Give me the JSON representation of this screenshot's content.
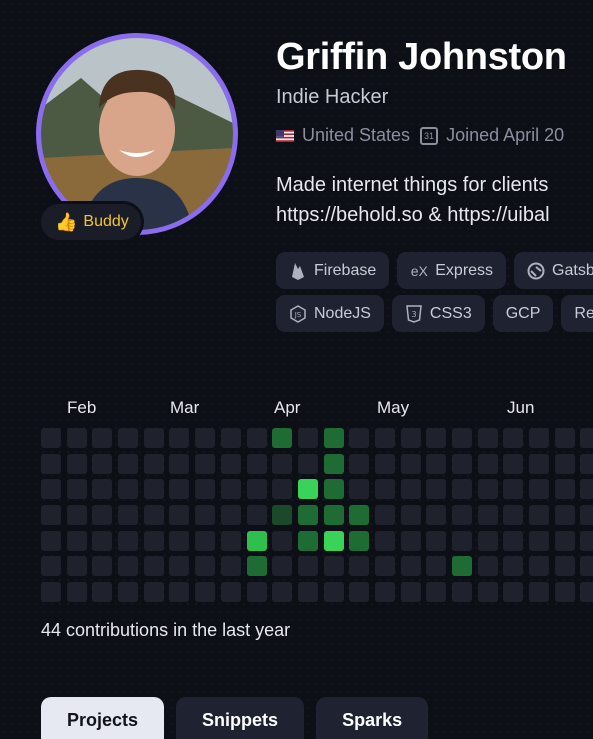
{
  "profile": {
    "name": "Griffin Johnston",
    "role": "Indie Hacker",
    "badge_label": "Buddy",
    "badge_icon": "thumbs-up-icon",
    "location": "United States",
    "joined": "Joined April 20",
    "bio_line1": "Made internet things for clients",
    "bio_line2": "https://behold.so & https://uibal"
  },
  "tags": {
    "row1": [
      {
        "label": "Firebase",
        "icon": "firebase-icon"
      },
      {
        "label": "Express",
        "icon": "express-icon"
      },
      {
        "label": "Gatsb",
        "icon": "gatsby-icon"
      }
    ],
    "row2": [
      {
        "label": "NodeJS",
        "icon": "nodejs-icon"
      },
      {
        "label": "CSS3",
        "icon": "css3-icon"
      },
      {
        "label": "GCP",
        "icon": ""
      },
      {
        "label": "Rea",
        "icon": ""
      }
    ]
  },
  "heatmap": {
    "months": [
      "Feb",
      "Mar",
      "Apr",
      "May",
      "Jun"
    ],
    "contributions_text": "44 contributions in the last year",
    "colors": {
      "empty": "#1f222c",
      "l1": "#1a4a2a",
      "l2": "#1e6b33",
      "l3": "#2fbf4f",
      "l4": "#39d35a"
    }
  },
  "tabs": [
    {
      "label": "Projects",
      "active": true
    },
    {
      "label": "Snippets",
      "active": false
    },
    {
      "label": "Sparks",
      "active": false
    }
  ]
}
